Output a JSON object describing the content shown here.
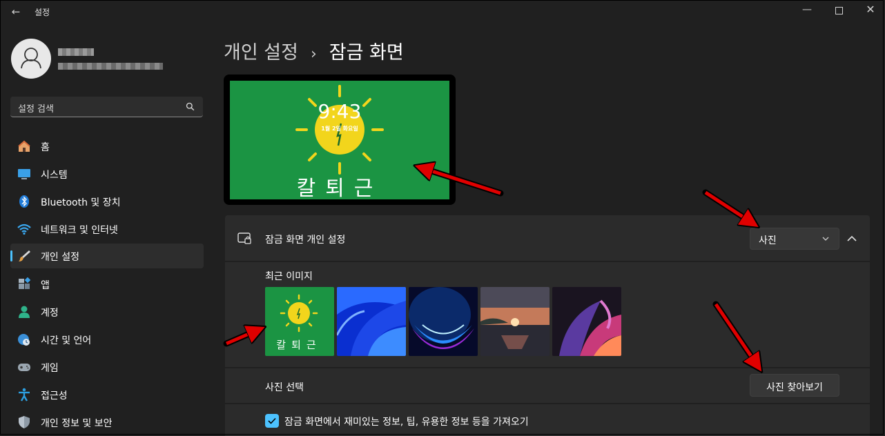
{
  "window": {
    "title": "설정"
  },
  "user": {
    "name": "",
    "email": ""
  },
  "search": {
    "placeholder": "설정 검색"
  },
  "sidebar": {
    "items": [
      {
        "label": "홈"
      },
      {
        "label": "시스템"
      },
      {
        "label": "Bluetooth 및 장치"
      },
      {
        "label": "네트워크 및 인터넷"
      },
      {
        "label": "개인 설정"
      },
      {
        "label": "앱"
      },
      {
        "label": "계정"
      },
      {
        "label": "시간 및 언어"
      },
      {
        "label": "게임"
      },
      {
        "label": "접근성"
      },
      {
        "label": "개인 정보 및 보안"
      }
    ],
    "active": "개인 설정"
  },
  "breadcrumb": {
    "parent": "개인 설정",
    "separator": "›",
    "current": "잠금 화면"
  },
  "preview": {
    "time": "9:43",
    "date": "1월 2일 화요일",
    "caption": "칼퇴근"
  },
  "lockscreen": {
    "title": "잠금 화면 개인 설정",
    "dropdown_value": "사진",
    "recent_label": "최근 이미지",
    "thumbnails": [
      "sun-green",
      "blue-waves",
      "blue-bloom",
      "sunset-lake",
      "purple-ribbon"
    ],
    "thumbnail_caption": "칼퇴근",
    "choose_photo_label": "사진 선택",
    "browse_label": "사진 찾아보기",
    "fun_facts_label": "잠금 화면에서 재미있는 정보, 팁, 유용한 정보 등을 가져오기",
    "fun_facts_checked": true
  },
  "colors": {
    "background": "#202020",
    "card": "#2b2b2b",
    "accent": "#4cc2ff",
    "preview_green": "#1b9443",
    "sun": "#f2d51c",
    "annotation": "#e00000"
  }
}
